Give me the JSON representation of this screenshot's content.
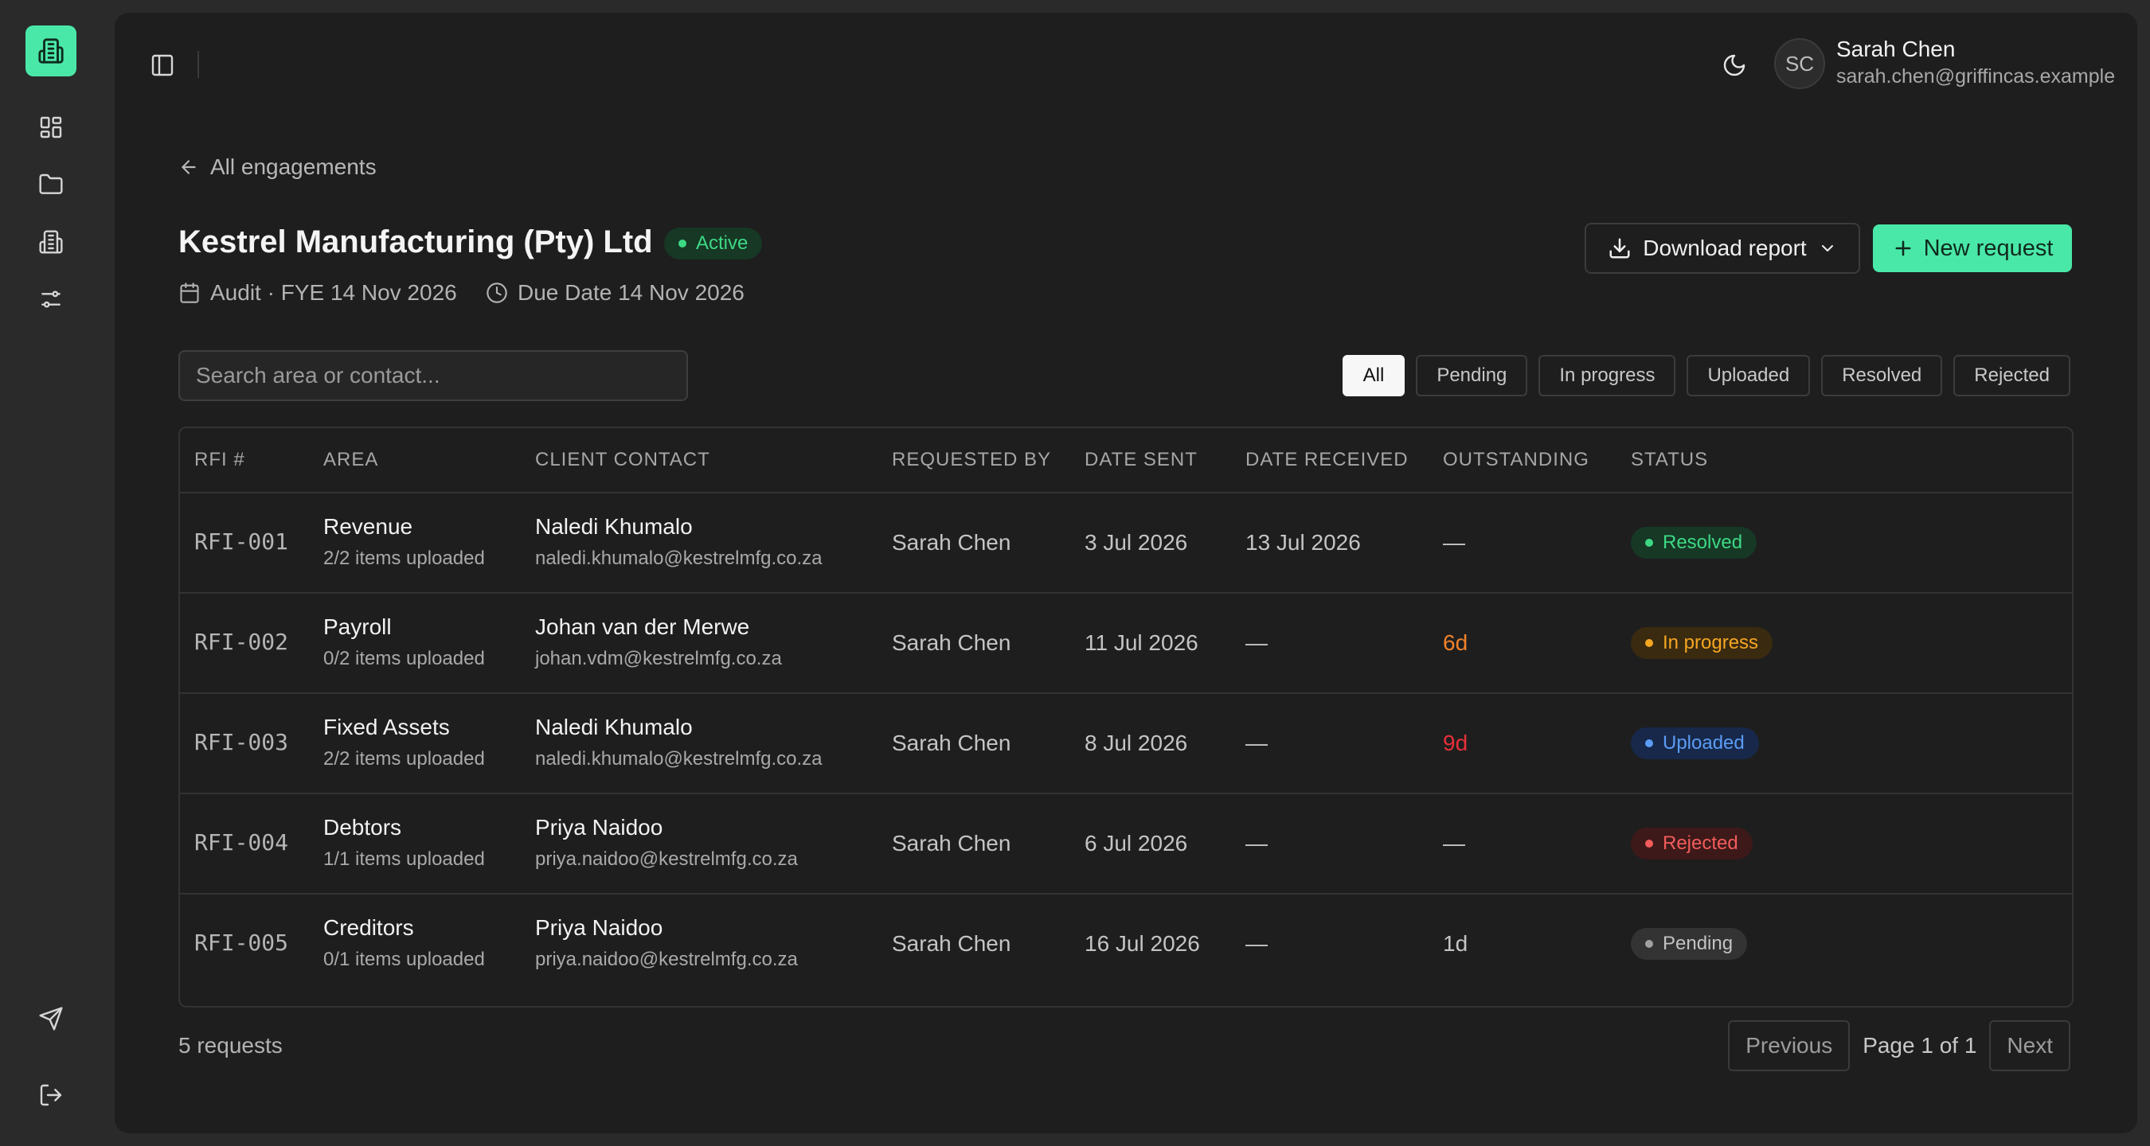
{
  "sidebar": {
    "logo_icon": "building-icon",
    "items": [
      {
        "name": "dashboard",
        "icon": "grid-icon"
      },
      {
        "name": "files",
        "icon": "folder-icon"
      },
      {
        "name": "clients",
        "icon": "building-icon"
      },
      {
        "name": "settings",
        "icon": "sliders-icon"
      }
    ],
    "bottom": [
      {
        "name": "send",
        "icon": "send-icon"
      },
      {
        "name": "logout",
        "icon": "logout-icon"
      }
    ]
  },
  "header": {
    "user": {
      "initials": "SC",
      "name": "Sarah Chen",
      "email": "sarah.chen@griffincas.example"
    }
  },
  "page": {
    "back_label": "All engagements",
    "title": "Kestrel Manufacturing (Pty) Ltd",
    "status": "Active",
    "meta_type": "Audit · FYE 14 Nov 2026",
    "meta_due": "Due Date 14 Nov 2026",
    "download_label": "Download report",
    "new_request_label": "New request"
  },
  "search": {
    "placeholder": "Search area or contact...",
    "value": ""
  },
  "filters": [
    "All",
    "Pending",
    "In progress",
    "Uploaded",
    "Resolved",
    "Rejected"
  ],
  "filters_selected": "All",
  "table": {
    "columns": [
      "RFI #",
      "AREA",
      "CLIENT CONTACT",
      "REQUESTED BY",
      "DATE SENT",
      "DATE RECEIVED",
      "OUTSTANDING",
      "STATUS"
    ],
    "rows": [
      {
        "rfi": "RFI-001",
        "area": "Revenue",
        "items": "2/2 items uploaded",
        "contact": "Naledi Khumalo",
        "email": "naledi.khumalo@kestrelmfg.co.za",
        "requested_by": "Sarah Chen",
        "date_sent": "3 Jul 2026",
        "date_received": "13 Jul 2026",
        "outstanding": "—",
        "outstanding_color": "#c4c4c4",
        "status": "Resolved",
        "status_class": "st-resolved"
      },
      {
        "rfi": "RFI-002",
        "area": "Payroll",
        "items": "0/2 items uploaded",
        "contact": "Johan van der Merwe",
        "email": "johan.vdm@kestrelmfg.co.za",
        "requested_by": "Sarah Chen",
        "date_sent": "11 Jul 2026",
        "date_received": "—",
        "outstanding": "6d",
        "outstanding_color": "#f0822a",
        "status": "In progress",
        "status_class": "st-progress"
      },
      {
        "rfi": "RFI-003",
        "area": "Fixed Assets",
        "items": "2/2 items uploaded",
        "contact": "Naledi Khumalo",
        "email": "naledi.khumalo@kestrelmfg.co.za",
        "requested_by": "Sarah Chen",
        "date_sent": "8 Jul 2026",
        "date_received": "—",
        "outstanding": "9d",
        "outstanding_color": "#e8303a",
        "status": "Uploaded",
        "status_class": "st-uploaded"
      },
      {
        "rfi": "RFI-004",
        "area": "Debtors",
        "items": "1/1 items uploaded",
        "contact": "Priya Naidoo",
        "email": "priya.naidoo@kestrelmfg.co.za",
        "requested_by": "Sarah Chen",
        "date_sent": "6 Jul 2026",
        "date_received": "—",
        "outstanding": "—",
        "outstanding_color": "#c4c4c4",
        "status": "Rejected",
        "status_class": "st-rejected"
      },
      {
        "rfi": "RFI-005",
        "area": "Creditors",
        "items": "0/1 items uploaded",
        "contact": "Priya Naidoo",
        "email": "priya.naidoo@kestrelmfg.co.za",
        "requested_by": "Sarah Chen",
        "date_sent": "16 Jul 2026",
        "date_received": "—",
        "outstanding": "1d",
        "outstanding_color": "#c4c4c4",
        "status": "Pending",
        "status_class": "st-pending"
      }
    ]
  },
  "footer": {
    "count_label": "5 requests",
    "previous_label": "Previous",
    "page_label": "Page 1 of 1",
    "next_label": "Next"
  },
  "colors": {
    "accent": "#4ae8a8",
    "background": "#1e1e1e"
  }
}
